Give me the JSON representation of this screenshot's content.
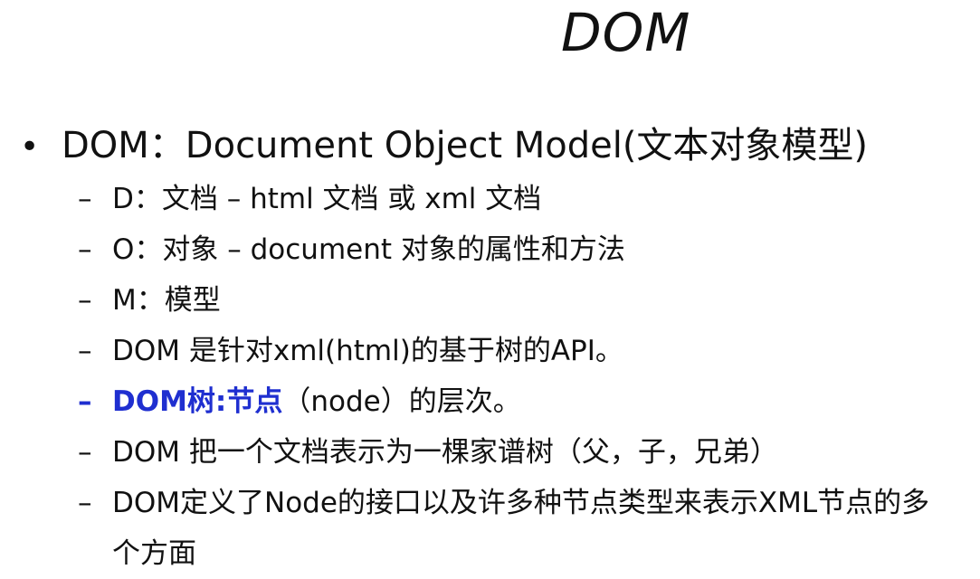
{
  "slide": {
    "title": "DOM",
    "bullet": {
      "symbol": "•",
      "text": "DOM：Document Object Model(文本对象模型)"
    },
    "sub_items": [
      {
        "dash": "–",
        "text": "D：文档 – html 文档 或 xml 文档"
      },
      {
        "dash": "–",
        "text": "O：对象 – document 对象的属性和方法"
      },
      {
        "dash": "–",
        "text": "M：模型"
      },
      {
        "dash": "–",
        "text": "DOM 是针对xml(html)的基于树的API。"
      },
      {
        "dash": "–",
        "text_highlight": "DOM树:节点",
        "text_rest": "（node）的层次。"
      },
      {
        "dash": "–",
        "text": "DOM 把一个文档表示为一棵家谱树（父，子，兄弟）"
      },
      {
        "dash": "–",
        "text": "DOM定义了Node的接口以及许多种节点类型来表示XML节点的多个方面"
      }
    ],
    "colors": {
      "text": "#111111",
      "highlight": "#1f2fd0",
      "background": "#ffffff"
    }
  }
}
